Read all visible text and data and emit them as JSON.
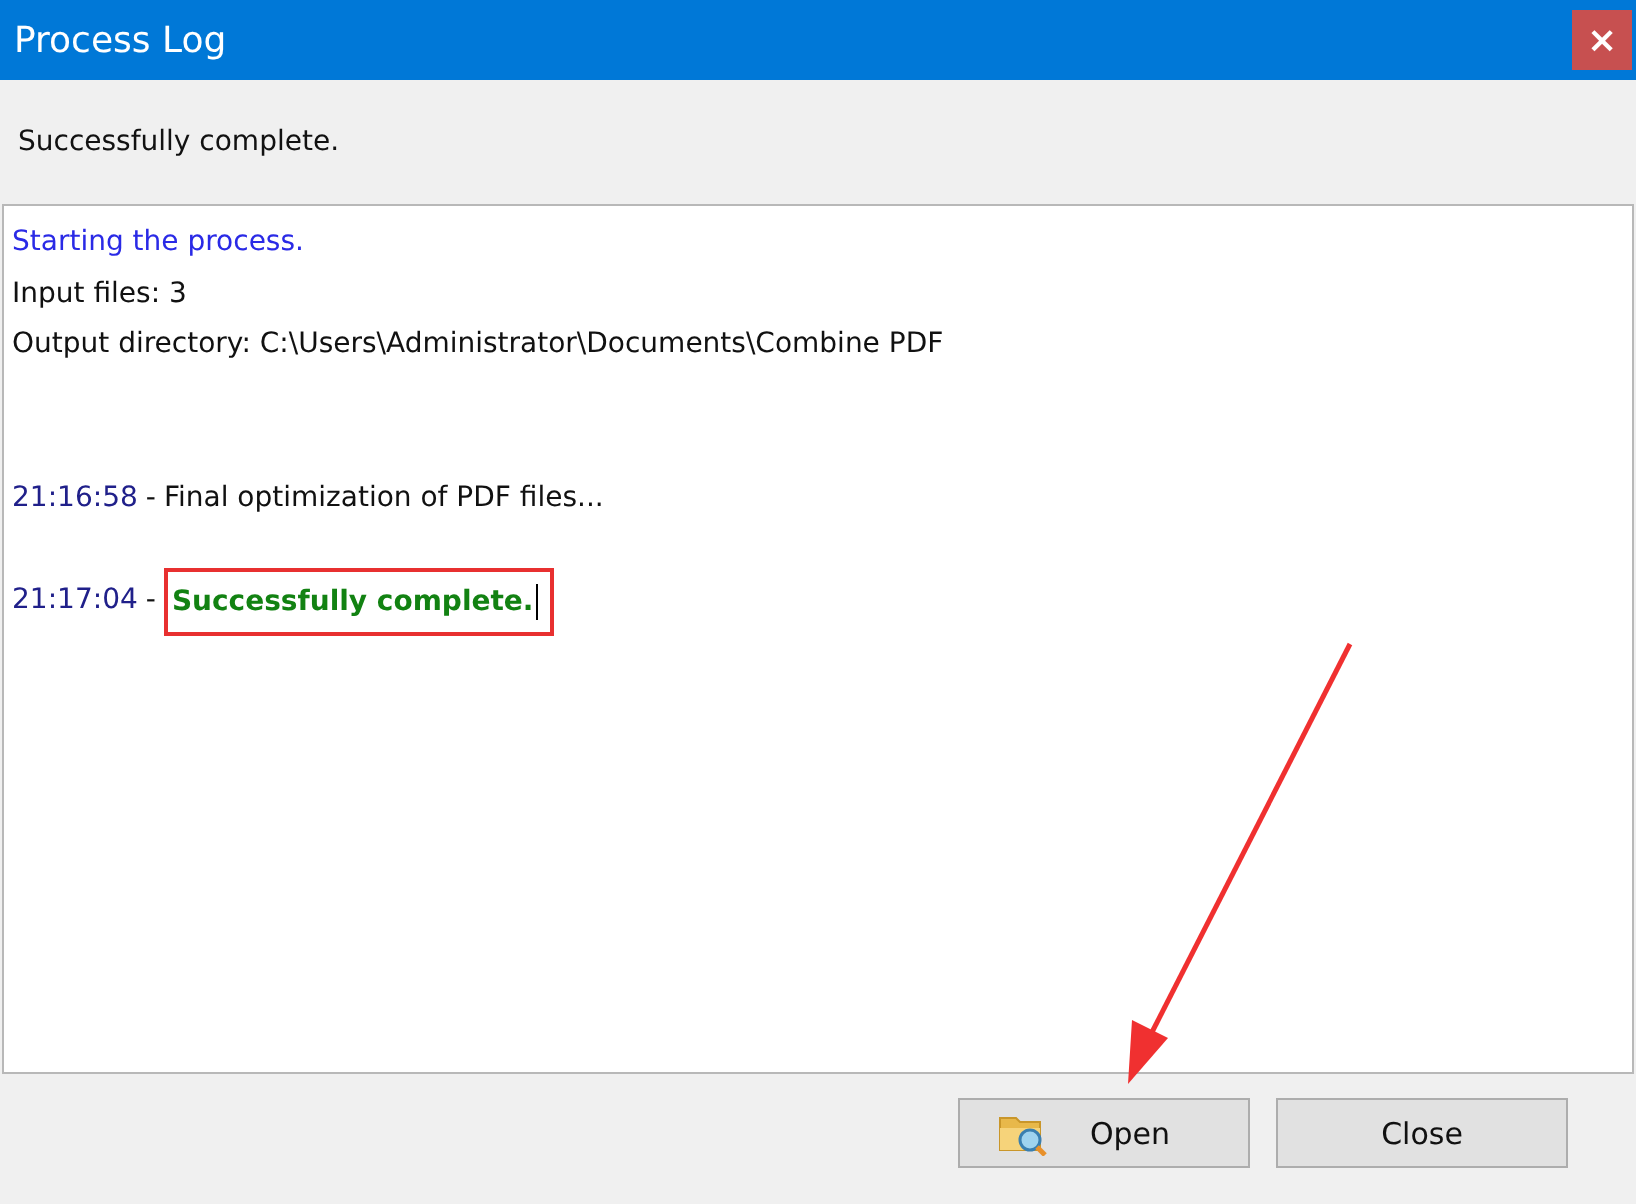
{
  "window": {
    "title": "Process Log",
    "close": "×"
  },
  "status": "Successfully complete.",
  "log": [
    {
      "kind": "info",
      "text": "Starting the process."
    },
    {
      "kind": "plain",
      "text": "Input files: 3"
    },
    {
      "kind": "plain",
      "text": "Output directory: C:\\Users\\Administrator\\Documents\\Combine PDF"
    },
    {
      "kind": "blank"
    },
    {
      "kind": "blank"
    },
    {
      "kind": "timed",
      "time": "21:16:58",
      "separator": "-",
      "text": "Final optimization of PDF files...",
      "success": false,
      "highlighted": false
    },
    {
      "kind": "blank"
    },
    {
      "kind": "timed",
      "time": "21:17:04",
      "separator": "-",
      "text": "Successfully complete.",
      "success": true,
      "highlighted": true
    }
  ],
  "buttons": [
    {
      "kind": "open",
      "label": "Open"
    },
    {
      "kind": "close",
      "label": "Close"
    }
  ]
}
